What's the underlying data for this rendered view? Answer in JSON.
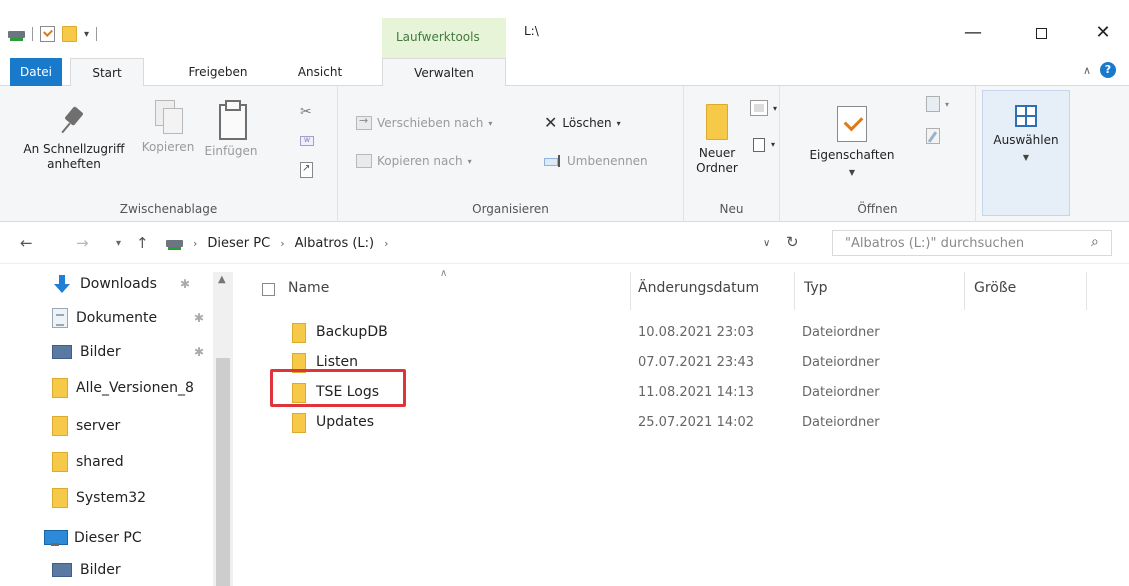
{
  "titlebar": {
    "contextual_tab_title": "Laufwerktools",
    "window_path": "L:\\",
    "minimize": "—",
    "close": "✕"
  },
  "tabs": {
    "file": "Datei",
    "start": "Start",
    "share": "Freigeben",
    "view": "Ansicht",
    "manage": "Verwalten"
  },
  "ribbon": {
    "clipboard": {
      "label": "Zwischenablage",
      "pin_line1": "An Schnellzugriff",
      "pin_line2": "anheften",
      "copy": "Kopieren",
      "paste": "Einfügen"
    },
    "organize": {
      "label": "Organisieren",
      "move_to": "Verschieben nach",
      "copy_to": "Kopieren nach",
      "delete": "Löschen",
      "rename": "Umbenennen"
    },
    "new": {
      "label": "Neu",
      "new_folder_line1": "Neuer",
      "new_folder_line2": "Ordner"
    },
    "open": {
      "label": "Öffnen",
      "properties": "Eigenschaften"
    },
    "select": {
      "label": "Auswählen"
    }
  },
  "address": {
    "segments": [
      "Dieser PC",
      "Albatros (L:)"
    ],
    "search_placeholder": "\"Albatros (L:)\" durchsuchen"
  },
  "navpane": {
    "items": [
      {
        "label": "Downloads",
        "icon": "download-icon",
        "pinned": true
      },
      {
        "label": "Dokumente",
        "icon": "documents-icon",
        "pinned": true
      },
      {
        "label": "Bilder",
        "icon": "pictures-icon",
        "pinned": true
      },
      {
        "label": "Alle_Versionen_8",
        "icon": "folder-icon",
        "pinned": false
      },
      {
        "label": "server",
        "icon": "folder-icon",
        "pinned": false
      },
      {
        "label": "shared",
        "icon": "folder-icon",
        "pinned": false
      },
      {
        "label": "System32",
        "icon": "folder-icon",
        "pinned": false
      },
      {
        "label": "Dieser PC",
        "icon": "this-pc-icon",
        "pinned": false
      },
      {
        "label": "Bilder",
        "icon": "pictures-icon",
        "pinned": false
      }
    ]
  },
  "filelist": {
    "columns": {
      "name": "Name",
      "date": "Änderungsdatum",
      "type": "Typ",
      "size": "Größe"
    },
    "rows": [
      {
        "name": "BackupDB",
        "date": "10.08.2021 23:03",
        "type": "Dateiordner"
      },
      {
        "name": "Listen",
        "date": "07.07.2021 23:43",
        "type": "Dateiordner"
      },
      {
        "name": "TSE Logs",
        "date": "11.08.2021 14:13",
        "type": "Dateiordner"
      },
      {
        "name": "Updates",
        "date": "25.07.2021 14:02",
        "type": "Dateiordner"
      }
    ]
  },
  "colors": {
    "accent": "#1979ca",
    "folder": "#f7c948",
    "highlight": "#e0343d",
    "contextual_tab": "#e8f4d8"
  }
}
